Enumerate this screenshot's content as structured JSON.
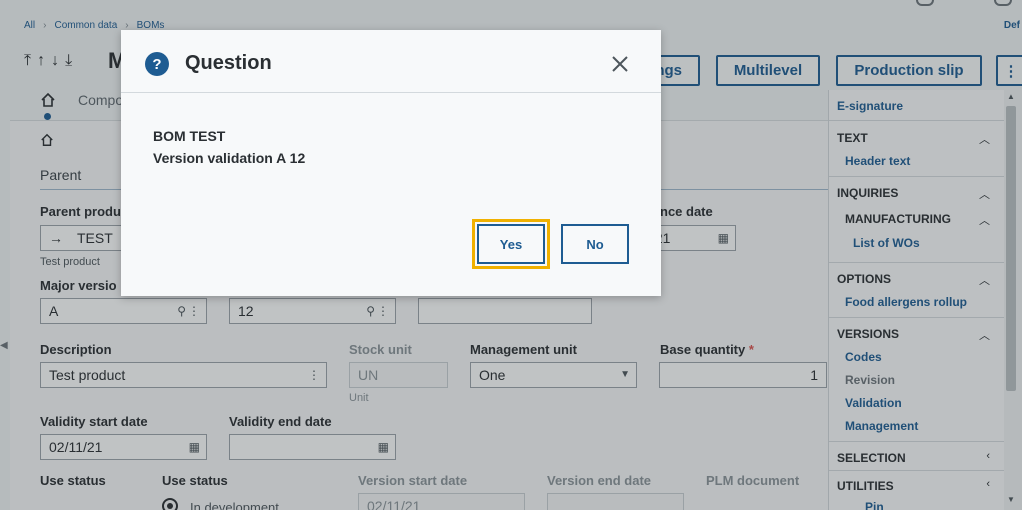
{
  "breadcrumb": {
    "items": [
      "All",
      "Common data",
      "BOMs"
    ],
    "default_label": "Def"
  },
  "toolbar": {
    "title": "M",
    "settings_label": "ngs",
    "multilevel_label": "Multilevel",
    "production_slip_label": "Production slip",
    "more_label": "⋮"
  },
  "tabs": {
    "components_label": "Compo"
  },
  "section": {
    "parent_title": "Parent"
  },
  "form": {
    "parent_product_label": "Parent produ",
    "parent_product_value": "TEST",
    "parent_product_desc": "Test product",
    "reference_date_label": "nce date",
    "reference_date_value": "/21",
    "major_version_label": "Major versio",
    "major_version_value": "A",
    "minor_version_value": "12",
    "description_label": "Description",
    "description_value": "Test product",
    "stock_unit_label": "Stock unit",
    "stock_unit_value": "UN",
    "stock_unit_sub": "Unit",
    "management_unit_label": "Management unit",
    "management_unit_value": "One",
    "base_quantity_label": "Base quantity",
    "base_quantity_value": "1",
    "required_mark": "*",
    "validity_start_label": "Validity start date",
    "validity_start_value": "02/11/21",
    "validity_end_label": "Validity end date",
    "use_status_label_1": "Use status",
    "use_status_label_2": "Use status",
    "version_start_label": "Version start date",
    "version_start_value": "02/11/21",
    "version_end_label": "Version end date",
    "plm_document_label": "PLM document",
    "radio_in_development": "In development"
  },
  "sidebar": {
    "esignature": "E-signature",
    "text_head": "TEXT",
    "header_text": "Header text",
    "inquiries_head": "INQUIRIES",
    "manufacturing_head": "MANUFACTURING",
    "list_of_wos": "List of WOs",
    "options_head": "OPTIONS",
    "food_allergens": "Food allergens rollup",
    "versions_head": "VERSIONS",
    "codes": "Codes",
    "revision": "Revision",
    "validation": "Validation",
    "management": "Management",
    "selection_head": "SELECTION",
    "utilities_head": "UTILITIES",
    "pin": "Pin"
  },
  "dialog": {
    "title": "Question",
    "message_line1": "BOM TEST",
    "message_line2": "Version validation A 12",
    "yes_label": "Yes",
    "no_label": "No"
  },
  "colors": {
    "accent": "#1e5c92",
    "focus": "#f0b100",
    "required": "#d9534f"
  }
}
